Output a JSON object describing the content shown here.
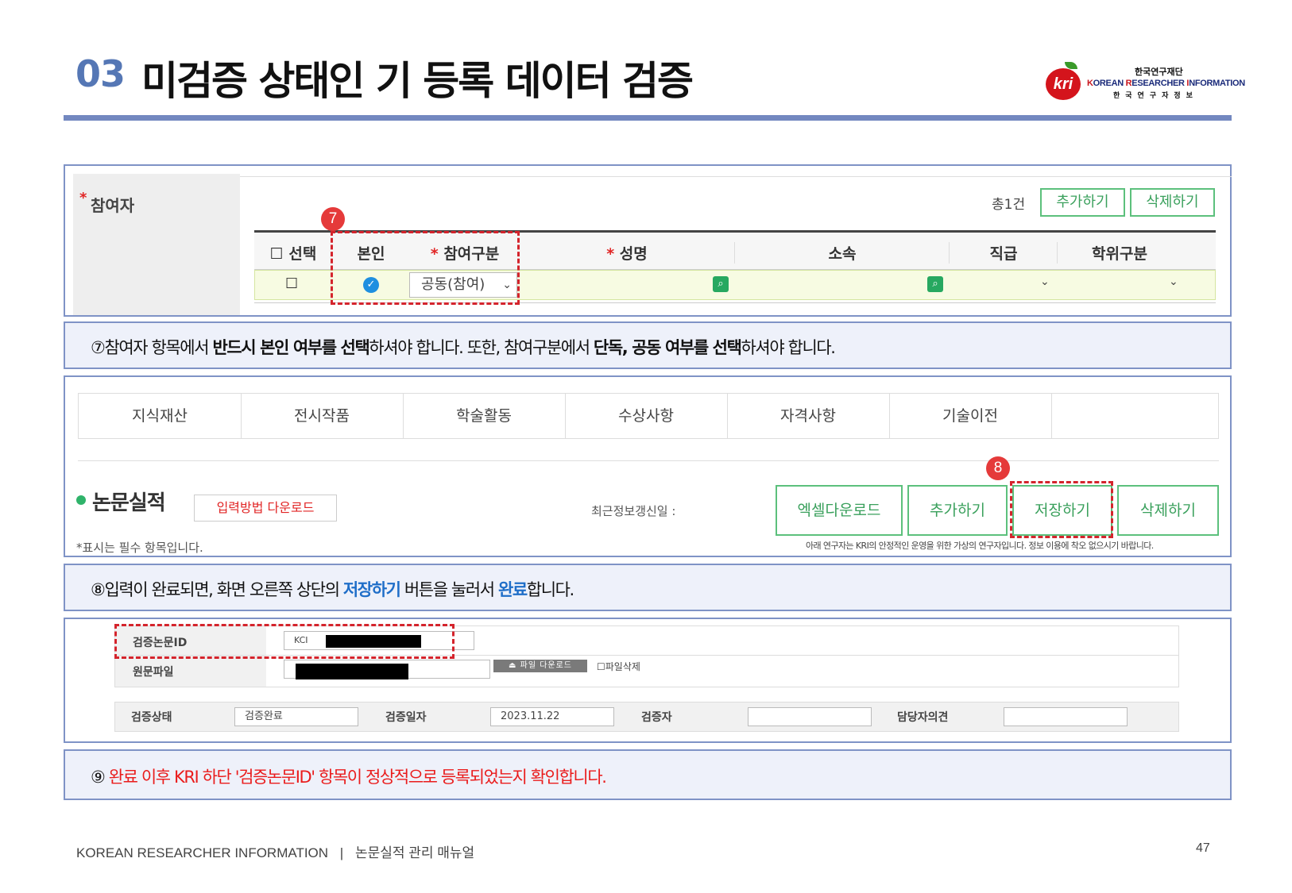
{
  "header": {
    "section_number": "03",
    "title": "미검증 상태인 기 등록 데이터 검증"
  },
  "logo": {
    "mark": "kri",
    "korean": "한국연구재단",
    "english_k": "K",
    "english_1": "OREAN ",
    "english_r": "R",
    "english_2": "ESEARCHER ",
    "english_i": "I",
    "english_3": "NFORMATION",
    "sub": "한국연구자정보"
  },
  "participants": {
    "label_star": "*",
    "label": "참여자",
    "total": "총1건",
    "add_button": "추가하기",
    "delete_button": "삭제하기",
    "badge": "7",
    "columns": {
      "select": "선택",
      "self": "본인",
      "type_star": "*",
      "type": "참여구분",
      "name_star": "*",
      "name": "성명",
      "affiliation": "소속",
      "position": "직급",
      "degree": "학위구분"
    },
    "row": {
      "type_value": "공동(참여)"
    }
  },
  "note7": {
    "num": "⑦",
    "p1": "참여자 항목에서 ",
    "b1": "반드시 본인 여부를 선택",
    "p2": "하셔야 합니다. 또한, 참여구분에서 ",
    "b2": "단독, 공동 여부를 선택",
    "p3": "하셔야 합니다."
  },
  "papers": {
    "tabs": [
      "지식재산",
      "전시작품",
      "학술활동",
      "수상사항",
      "자격사항",
      "기술이전"
    ],
    "section_title": "논문실적",
    "download_guide": "입력방법 다운로드",
    "last_update_label": "최근정보갱신일 :",
    "badge": "8",
    "excel_button": "엑셀다운로드",
    "add_button": "추가하기",
    "save_button": "저장하기",
    "delete_button": "삭제하기",
    "required_note": "*표시는 필수 항목입니다.",
    "virtual_note": "아래 연구자는 KRI의 안정적인 운영을 위한 가상의 연구자입니다. 정보 이용에 착오 없으시기 바랍니다."
  },
  "note8": {
    "num": "⑧",
    "p1": "입력이 완료되면, 화면 오른쪽 상단의 ",
    "b1": "저장하기",
    "p2": " 버튼을 눌러서 ",
    "b2": "완료",
    "p3": "합니다."
  },
  "verify": {
    "paper_id_label": "검증논문ID",
    "paper_id_prefix": "KCI",
    "original_file_label": "원문파일",
    "file_download": "파일 다운로드",
    "file_delete": "파일삭제",
    "status_label": "검증상태",
    "status_value": "검증완료",
    "date_label": "검증일자",
    "date_value": "2023.11.22",
    "verifier_label": "검증자",
    "manager_opinion_label": "담당자의견"
  },
  "note9": {
    "num": "⑨",
    "text": "완료 이후 KRI 하단 '검증논문ID' 항목이 정상적으로 등록되었는지 확인합니다."
  },
  "footer": {
    "left": "KOREAN RESEARCHER INFORMATION",
    "sep": "|",
    "doc": "논문실적 관리 매뉴얼",
    "page": "47"
  },
  "colors": {
    "accent_blue": "#7f93c6",
    "title_blue": "#5577b5",
    "green": "#3aa05c",
    "red": "#d4242c"
  }
}
